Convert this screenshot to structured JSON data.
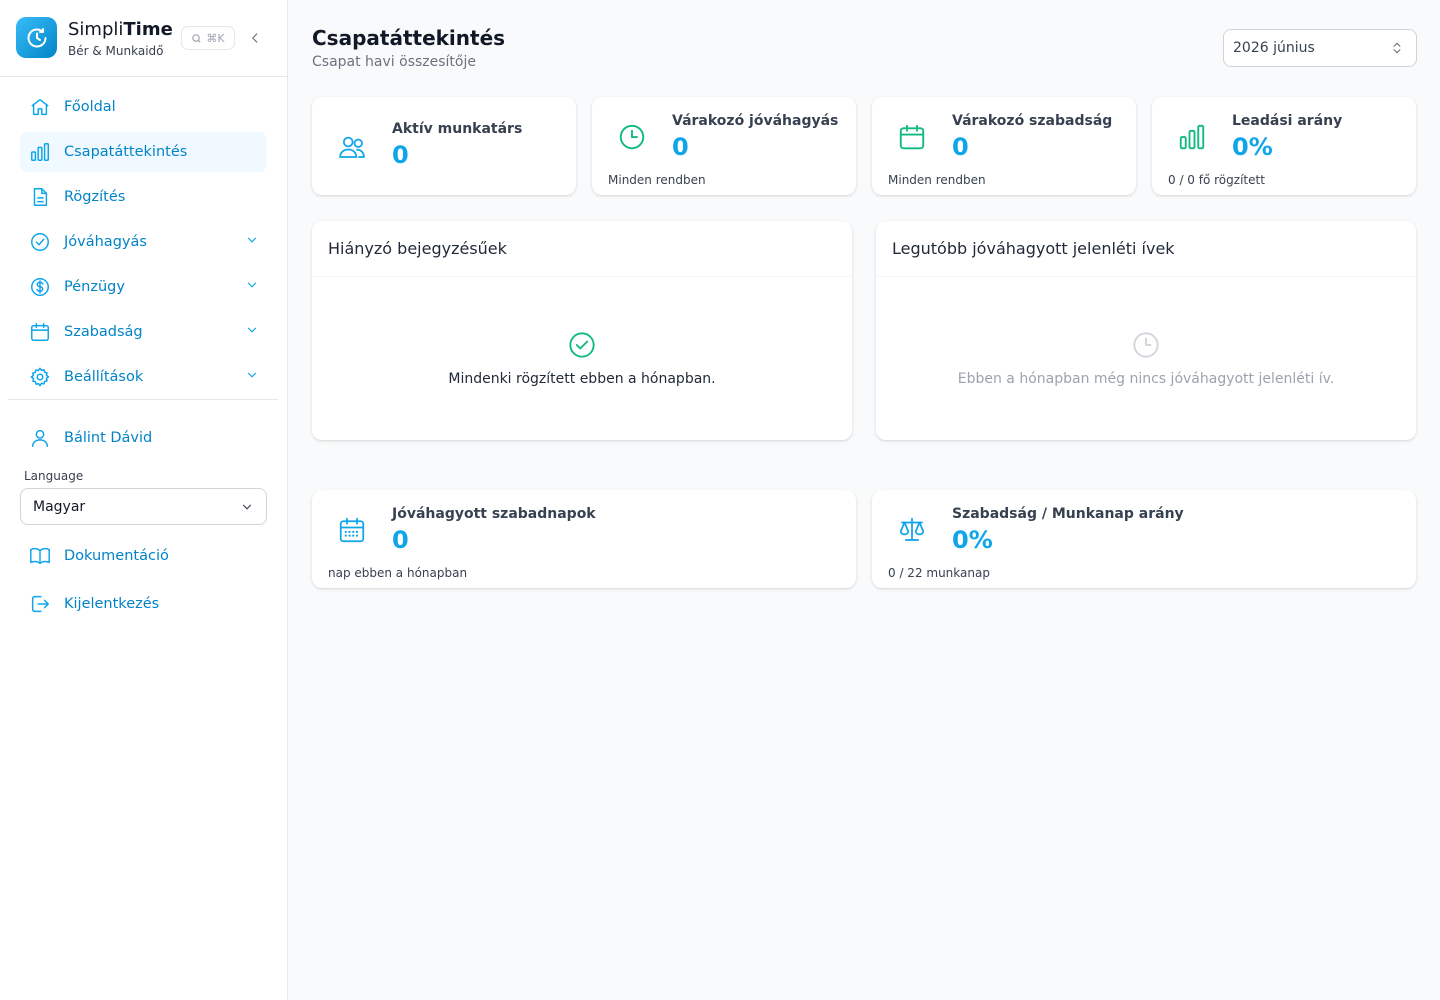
{
  "brand": {
    "name_prefix": "Simpli",
    "name_bold": "Time",
    "subtitle": "Bér & Munkaidő",
    "shortcut": "⌘K"
  },
  "sidebar": {
    "items": [
      {
        "label": "Főoldal",
        "icon": "home-icon"
      },
      {
        "label": "Csapatáttekintés",
        "icon": "bar-chart-icon",
        "active": true
      },
      {
        "label": "Rögzítés",
        "icon": "document-icon"
      },
      {
        "label": "Jóváhagyás",
        "icon": "check-circle-icon",
        "expandable": true
      },
      {
        "label": "Pénzügy",
        "icon": "dollar-circle-icon",
        "expandable": true
      },
      {
        "label": "Szabadság",
        "icon": "calendar-icon",
        "expandable": true
      },
      {
        "label": "Beállítások",
        "icon": "gear-icon",
        "expandable": true
      }
    ],
    "user": {
      "label": "Bálint Dávid",
      "icon": "user-icon"
    },
    "language": {
      "label": "Language",
      "value": "Magyar"
    },
    "docs": {
      "label": "Dokumentáció",
      "icon": "book-icon"
    },
    "logout": {
      "label": "Kijelentkezés",
      "icon": "logout-icon"
    }
  },
  "header": {
    "title": "Csapatáttekintés",
    "subtitle": "Csapat havi összesítője",
    "month": "2026 június"
  },
  "stats": [
    {
      "label": "Aktív munkatárs",
      "value": "0",
      "foot": "",
      "icon": "users-icon",
      "color": "#0ea5e9"
    },
    {
      "label": "Várakozó jóváhagyás",
      "value": "0",
      "foot": "Minden rendben",
      "icon": "clock-icon",
      "color": "#10b981"
    },
    {
      "label": "Várakozó szabadság",
      "value": "0",
      "foot": "Minden rendben",
      "icon": "calendar-icon",
      "color": "#10b981"
    },
    {
      "label": "Leadási arány",
      "value": "0%",
      "foot": "0 / 0 fő rögzített",
      "icon": "bar-chart-icon",
      "color": "#10b981"
    }
  ],
  "panels": {
    "missing": {
      "title": "Hiányzó bejegyzésűek",
      "message": "Mindenki rögzített ebben a hónapban.",
      "icon": "check-circle-icon"
    },
    "approved": {
      "title": "Legutóbb jóváhagyott jelenléti ívek",
      "message": "Ebben a hónapban még nincs jóváhagyott jelenléti ív.",
      "icon": "clock-icon"
    }
  },
  "bottom_stats": [
    {
      "label": "Jóváhagyott szabadnapok",
      "value": "0",
      "foot": "nap ebben a hónapban",
      "icon": "calendar-grid-icon"
    },
    {
      "label": "Szabadság / Munkanap arány",
      "value": "0%",
      "foot": "0 / 22 munkanap",
      "icon": "scale-icon"
    }
  ],
  "colors": {
    "accent": "#0ea5e9",
    "link": "#0284c7",
    "success": "#10b981",
    "muted": "#9ca3af"
  }
}
